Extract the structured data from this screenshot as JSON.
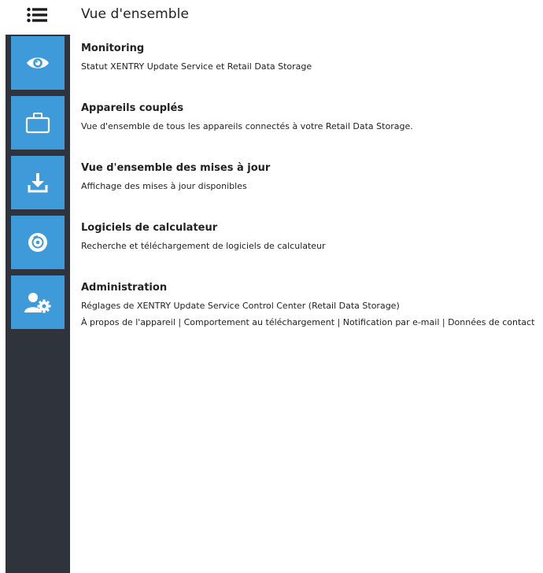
{
  "header": {
    "title": "Vue d'ensemble",
    "menu_icon": "list-menu-icon"
  },
  "colors": {
    "sidebar_bg": "#2f343c",
    "tile_bg": "#3e9ad8",
    "icon_fg": "#ffffff"
  },
  "sidebar": {
    "items": [
      {
        "icon": "eye-icon",
        "target": "monitoring"
      },
      {
        "icon": "briefcase-icon",
        "target": "paired-devices"
      },
      {
        "icon": "download-icon",
        "target": "updates"
      },
      {
        "icon": "disc-icon",
        "target": "ecu-software"
      },
      {
        "icon": "user-settings-icon",
        "target": "administration"
      }
    ]
  },
  "sections": [
    {
      "title": "Monitoring",
      "desc": "Statut XENTRY Update Service et Retail Data Storage"
    },
    {
      "title": "Appareils couplés",
      "desc": "Vue d'ensemble de tous les appareils connectés à votre Retail Data Storage."
    },
    {
      "title": "Vue d'ensemble des mises à jour",
      "desc": "Affichage des mises à jour disponibles"
    },
    {
      "title": "Logiciels de calculateur",
      "desc": "Recherche et téléchargement de logiciels de calculateur"
    },
    {
      "title": "Administration",
      "desc": "Réglages de XENTRY Update Service Control Center (Retail Data Storage)",
      "links": "À propos de l'appareil | Comportement au téléchargement | Notification par e-mail | Données de contact"
    }
  ]
}
